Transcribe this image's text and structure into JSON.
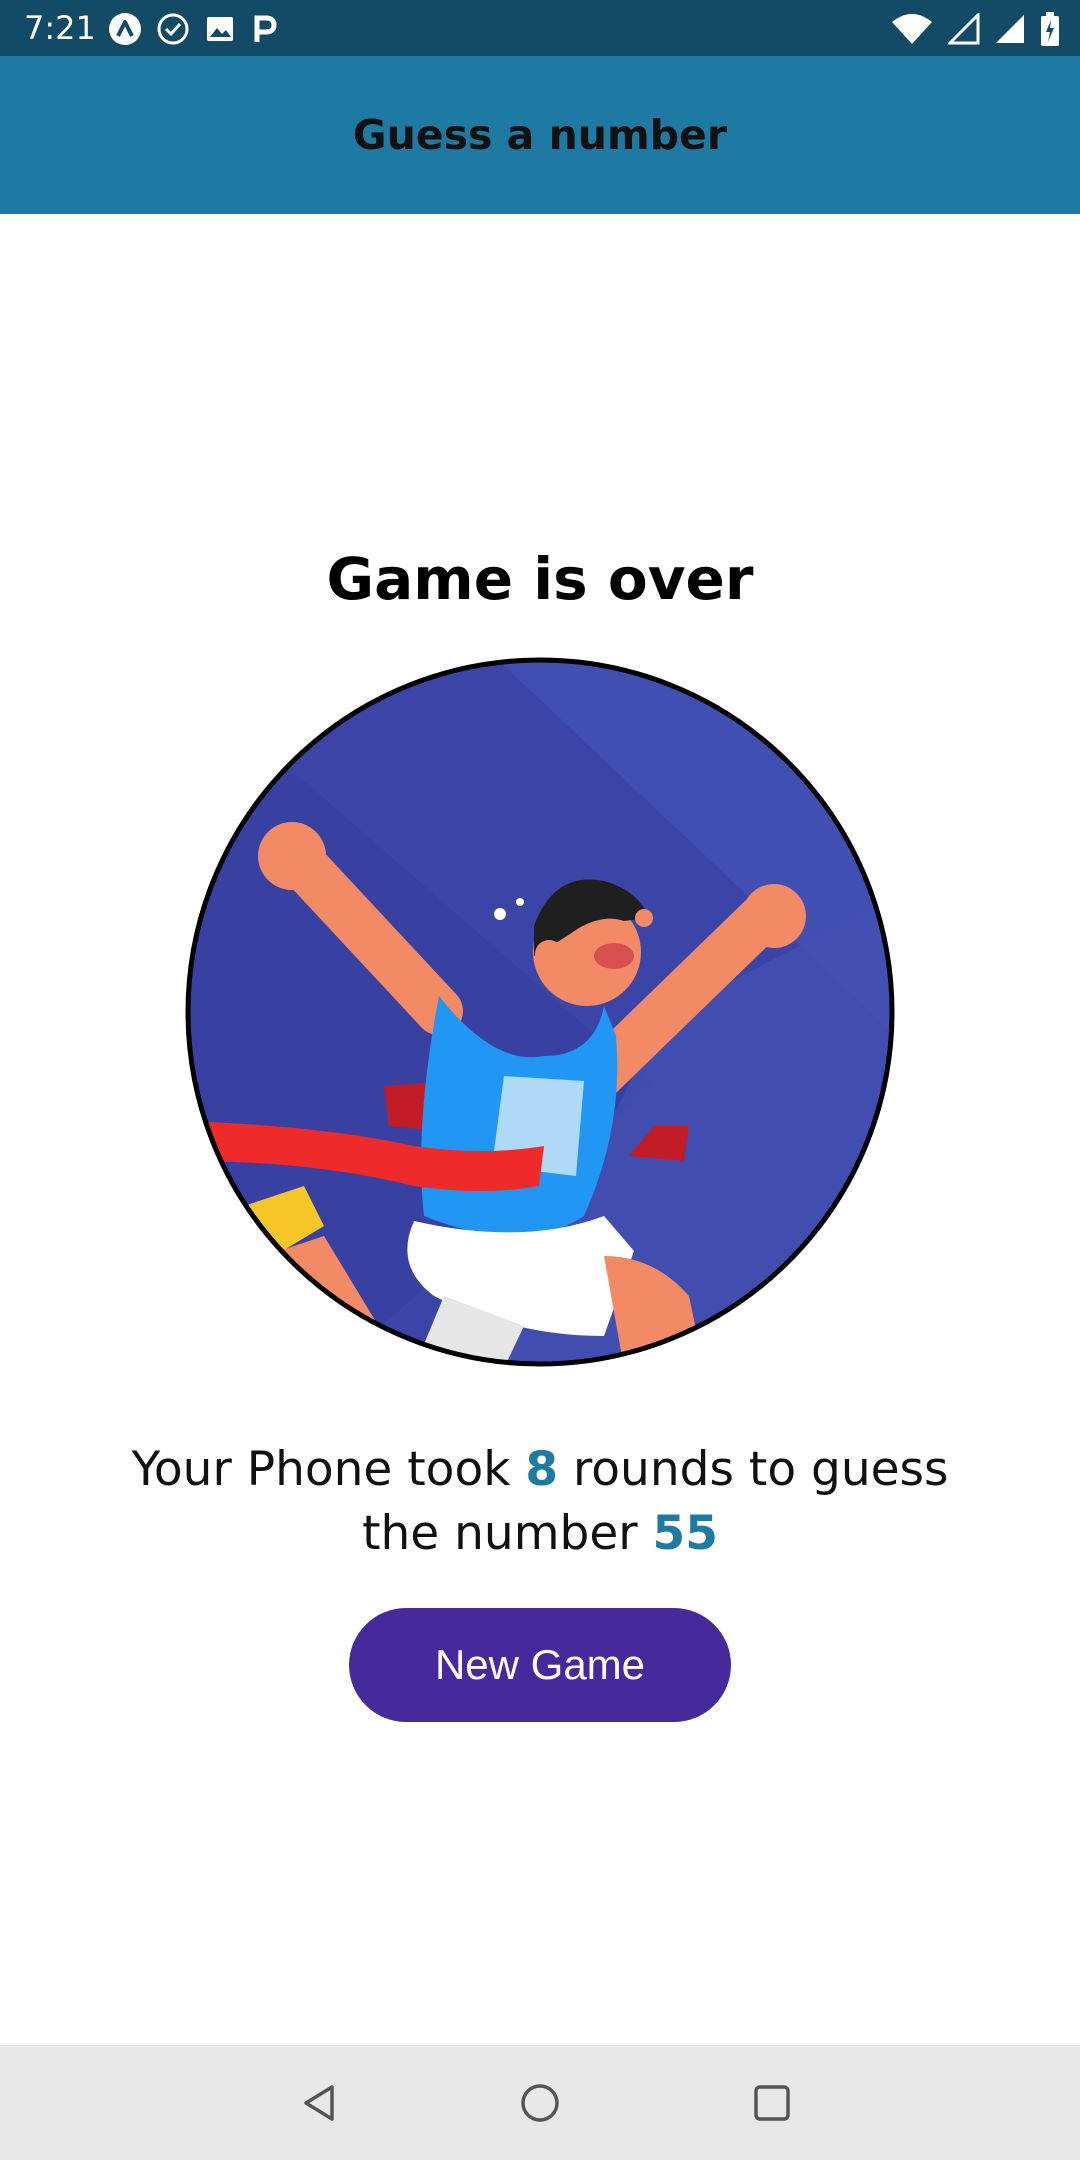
{
  "status_bar": {
    "time": "7:21",
    "icons_left": [
      "expo-icon",
      "check-circle-icon",
      "image-icon",
      "parking-icon"
    ],
    "icons_right": [
      "wifi-icon",
      "signal-empty-icon",
      "signal-icon",
      "battery-charging-icon"
    ]
  },
  "app_bar": {
    "title": "Guess a number",
    "color": "#1e7aa3"
  },
  "main": {
    "heading": "Game is over",
    "summary": {
      "prefix": "Your Phone took ",
      "rounds": "8",
      "middle": " rounds to guess the number ",
      "number": "55"
    },
    "new_game_label": "New Game",
    "button_color": "#46299b",
    "highlight_color": "#1e7aa3"
  },
  "nav_bar": {
    "buttons": [
      "back-icon",
      "home-icon",
      "recents-icon"
    ]
  }
}
